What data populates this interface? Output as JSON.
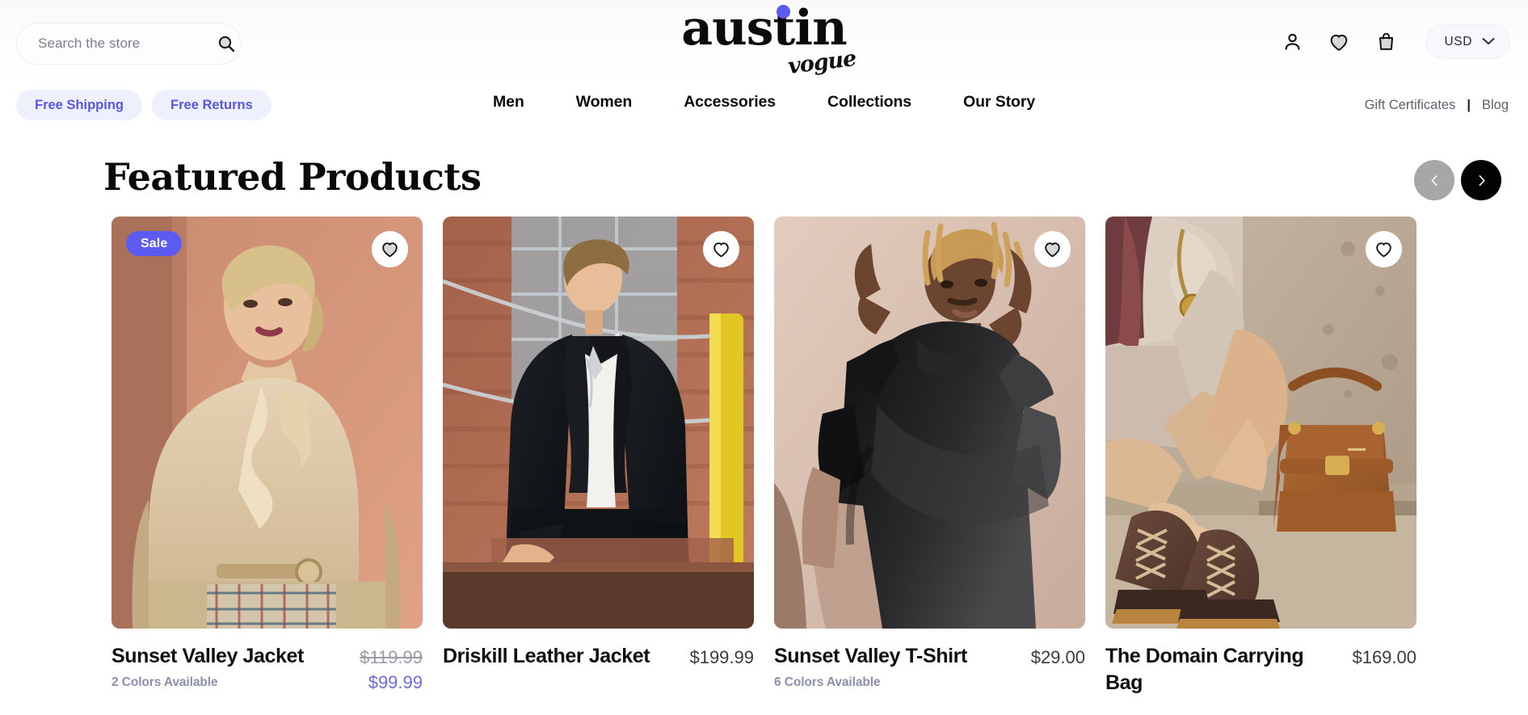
{
  "header": {
    "search": {
      "placeholder": "Search the store",
      "value": "",
      "icon": "search-icon"
    },
    "logo": {
      "main": "austin",
      "script": "vogue",
      "dot_color": "#5b5bf0"
    },
    "actions": [
      {
        "name": "account-icon",
        "label": "Account"
      },
      {
        "name": "wishlist-icon",
        "label": "Wishlist"
      },
      {
        "name": "cart-icon",
        "label": "Cart"
      }
    ],
    "currency": {
      "selected": "USD",
      "options": [
        "USD"
      ],
      "chevron": "chevron-down-icon"
    }
  },
  "promo_badges": [
    {
      "label": "Free Shipping"
    },
    {
      "label": "Free Returns"
    }
  ],
  "nav": {
    "items": [
      {
        "label": "Men"
      },
      {
        "label": "Women"
      },
      {
        "label": "Accessories"
      },
      {
        "label": "Collections"
      },
      {
        "label": "Our Story"
      }
    ],
    "utility": {
      "gift_certificates": "Gift Certificates",
      "separator": "|",
      "blog": "Blog"
    }
  },
  "section": {
    "title": "Featured Products",
    "carousel": {
      "prev_icon": "chevron-left-icon",
      "prev_state": "disabled",
      "next_icon": "chevron-right-icon",
      "next_state": "enabled"
    }
  },
  "colors": {
    "accent": "#5b5bf0",
    "badge_bg": "#eef0fd",
    "badge_text": "#5757e2",
    "sale_price": "#6c6ce0",
    "muted": "#8b8fae"
  },
  "products": [
    {
      "name": "Sunset Valley Jacket",
      "colors_available": "2 Colors Available",
      "price": "",
      "price_old": "$119.99",
      "price_sale": "$99.99",
      "badge": "Sale",
      "image_alt": "woman-in-beige-trench-coat"
    },
    {
      "name": "Driskill Leather Jacket",
      "colors_available": "",
      "price": "$199.99",
      "price_old": "",
      "price_sale": "",
      "badge": "",
      "image_alt": "man-in-black-leather-jacket"
    },
    {
      "name": "Sunset Valley T-Shirt",
      "colors_available": "6 Colors Available",
      "price": "$29.00",
      "price_old": "",
      "price_sale": "",
      "badge": "",
      "image_alt": "man-in-black-tshirt"
    },
    {
      "name": "The Domain Carrying Bag",
      "colors_available": "",
      "price": "$169.00",
      "price_old": "",
      "price_sale": "",
      "badge": "",
      "image_alt": "woman-lacing-boots-with-brown-handbag"
    }
  ]
}
